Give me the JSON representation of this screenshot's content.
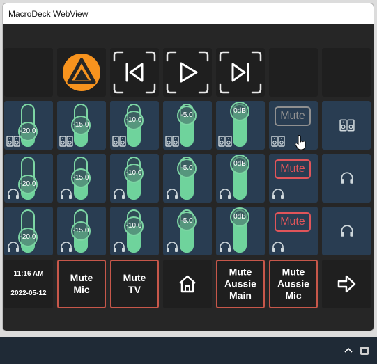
{
  "window": {
    "title": "MacroDeck WebView"
  },
  "colors": {
    "background": "#262626",
    "tile": "#1f1f1f",
    "volume_tile": "#293d52",
    "slider_accent": "#6fd39c",
    "mute_red": "#e0555a",
    "outline_red": "#c7574a",
    "media_orange": "#f7931e"
  },
  "media_row": {
    "buttons": [
      {
        "name": "empty",
        "icon": ""
      },
      {
        "name": "aimp-player",
        "icon": "aimp-logo-icon"
      },
      {
        "name": "previous",
        "icon": "skip-previous-icon"
      },
      {
        "name": "play",
        "icon": "play-icon"
      },
      {
        "name": "next",
        "icon": "skip-next-icon"
      },
      {
        "name": "empty",
        "icon": ""
      },
      {
        "name": "empty",
        "icon": ""
      }
    ]
  },
  "volume_rows": [
    {
      "device": "speakers",
      "icon": "speaker-icon",
      "levels": [
        "-20.0",
        "-15.0",
        "-10.0",
        "-5.0",
        "0dB"
      ],
      "fills": [
        0.35,
        0.5,
        0.62,
        0.72,
        0.82
      ],
      "mute": {
        "label": "Mute",
        "active": false
      }
    },
    {
      "device": "headphones",
      "icon": "headphones-icon",
      "levels": [
        "-20.0",
        "-15.0",
        "-10.0",
        "-5.0",
        "0dB"
      ],
      "fills": [
        0.35,
        0.5,
        0.62,
        0.72,
        0.82
      ],
      "mute": {
        "label": "Mute",
        "active": true
      }
    },
    {
      "device": "headphones",
      "icon": "headphones-icon",
      "levels": [
        "-20.0",
        "-15.0",
        "-10.0",
        "-5.0",
        "0dB"
      ],
      "fills": [
        0.35,
        0.5,
        0.62,
        0.72,
        0.82
      ],
      "mute": {
        "label": "Mute",
        "active": true
      }
    }
  ],
  "bottom_row": {
    "clock": {
      "time": "11:16 AM",
      "date": "2022-05-12"
    },
    "mute_mic": "Mute\nMic",
    "mute_tv": "Mute\nTV",
    "home": "home-icon",
    "mute_aussie_main": "Mute\nAussie\nMain",
    "mute_aussie_mic": "Mute\nAussie\nMic",
    "next_page": "arrow-right-icon"
  }
}
